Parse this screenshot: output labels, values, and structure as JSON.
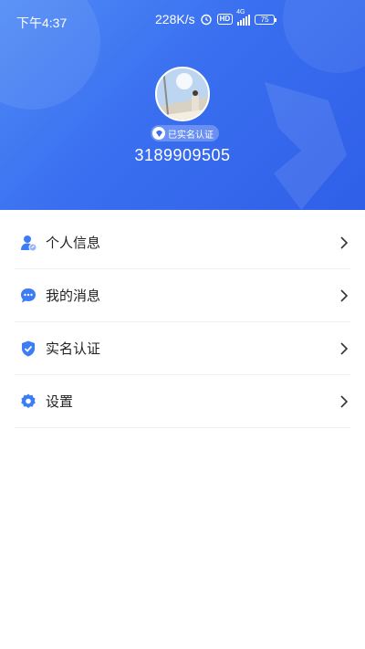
{
  "status_bar": {
    "time": "下午4:37",
    "speed": "228K/s",
    "hd": "HD",
    "network": "4G",
    "battery": "75"
  },
  "profile": {
    "verified_label": "已实名认证",
    "phone": "3189909505"
  },
  "menu": {
    "items": [
      {
        "label": "个人信息",
        "icon": "user-info-icon"
      },
      {
        "label": "我的消息",
        "icon": "message-icon"
      },
      {
        "label": "实名认证",
        "icon": "verified-shield-icon"
      },
      {
        "label": "设置",
        "icon": "gear-icon"
      }
    ]
  },
  "colors": {
    "header_blue": "#3a6ff0",
    "icon_blue": "#3c7cf5"
  }
}
